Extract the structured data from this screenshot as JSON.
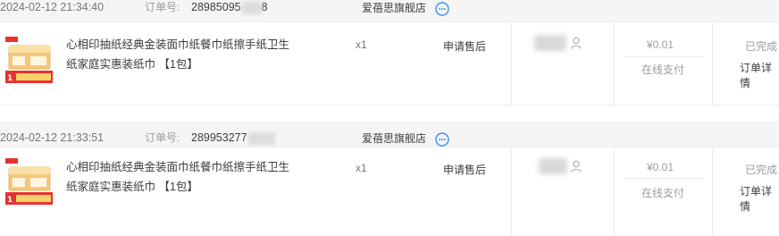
{
  "orders": [
    {
      "time": "2024-02-12 21:34:40",
      "order_label": "订单号:",
      "order_no": "28985095",
      "order_no_tail": "8",
      "shop": "爱蓓思旗舰店",
      "product_title": "心相印抽纸经典金装面巾纸餐巾纸擦手纸卫生纸家庭实惠装纸巾 【1包】",
      "quantity": "x1",
      "aftersale_label": "申请售后",
      "price": "¥0.01",
      "payment": "在线支付",
      "status": "已完成",
      "detail_label": "订单详情"
    },
    {
      "time": "2024-02-12 21:33:51",
      "order_label": "订单号:",
      "order_no": "289953277",
      "order_no_tail": "",
      "shop": "爱蓓思旗舰店",
      "product_title": "心相印抽纸经典金装面巾纸餐巾纸擦手纸卫生纸家庭实惠装纸巾 【1包】",
      "quantity": "x1",
      "aftersale_label": "申请售后",
      "price": "¥0.01",
      "payment": "在线支付",
      "status": "已完成",
      "detail_label": "订单详情"
    }
  ],
  "icons": {
    "chat": "chat-bubble-icon",
    "user": "user-icon",
    "thumb": "tissue-package-thumbnail"
  },
  "colors": {
    "accent_blue": "#3e8ef7",
    "header_bg": "#f5f5f5",
    "border": "#ececec",
    "text": "#3c3c3c",
    "muted": "#9c9c9c"
  }
}
